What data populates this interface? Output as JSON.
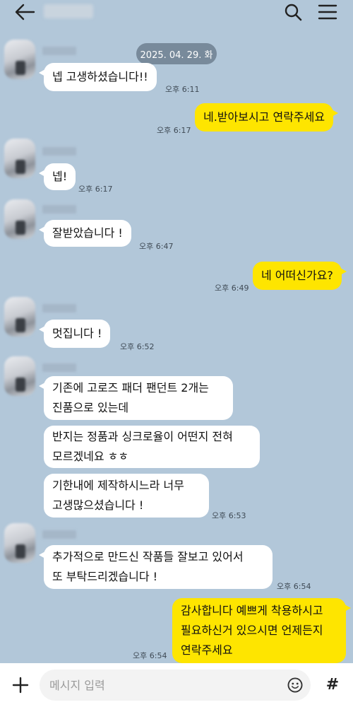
{
  "header": {
    "back_icon": "arrow-left-icon",
    "search_icon": "search-icon",
    "menu_icon": "hamburger-menu-icon"
  },
  "date_divider": "2025. 04. 29. 화",
  "messages": [
    {
      "side": "in",
      "text": "넵 고생하셨습니다!!",
      "time": "오후 6:11"
    },
    {
      "side": "out",
      "text": "네.받아보시고 연락주세요",
      "time": "오후 6:17"
    },
    {
      "side": "in",
      "text": "넵!",
      "time": "오후 6:17"
    },
    {
      "side": "in",
      "text": "잘받았습니다 !",
      "time": "오후 6:47"
    },
    {
      "side": "out",
      "text": "네 어떠신가요?",
      "time": "오후 6:49"
    },
    {
      "side": "in",
      "text": "멋집니다 !",
      "time": "오후 6:52"
    },
    {
      "side": "in",
      "lines": [
        "기존에 고로즈 패더 팬던트 2개는",
        "진품으로 있는데"
      ]
    },
    {
      "side": "in",
      "lines": [
        "반지는 정품과 싱크로율이 어떤지 전혀",
        "모르겠네요 ㅎㅎ"
      ]
    },
    {
      "side": "in",
      "lines": [
        "기한내에 제작하시느라 너무",
        "고생많으셨습니다 !"
      ],
      "time": "오후 6:53"
    },
    {
      "side": "in",
      "lines": [
        "추가적으로 만드신 작품들 잘보고 있어서",
        "또 부탁드리겠습니다 !"
      ],
      "time": "오후 6:54"
    },
    {
      "side": "out",
      "lines": [
        "감사합니다 예쁘게 착용하시고",
        "필요하신거 있으시면 언제든지",
        "연락주세요"
      ],
      "time": "오후 6:54"
    }
  ],
  "input_bar": {
    "plus_icon": "plus-icon",
    "placeholder": "메시지 입력",
    "emoji_icon": "emoji-icon",
    "hash_label": "#"
  },
  "colors": {
    "background": "#b2c7d9",
    "incoming_bubble": "#ffffff",
    "outgoing_bubble": "#fee500"
  }
}
